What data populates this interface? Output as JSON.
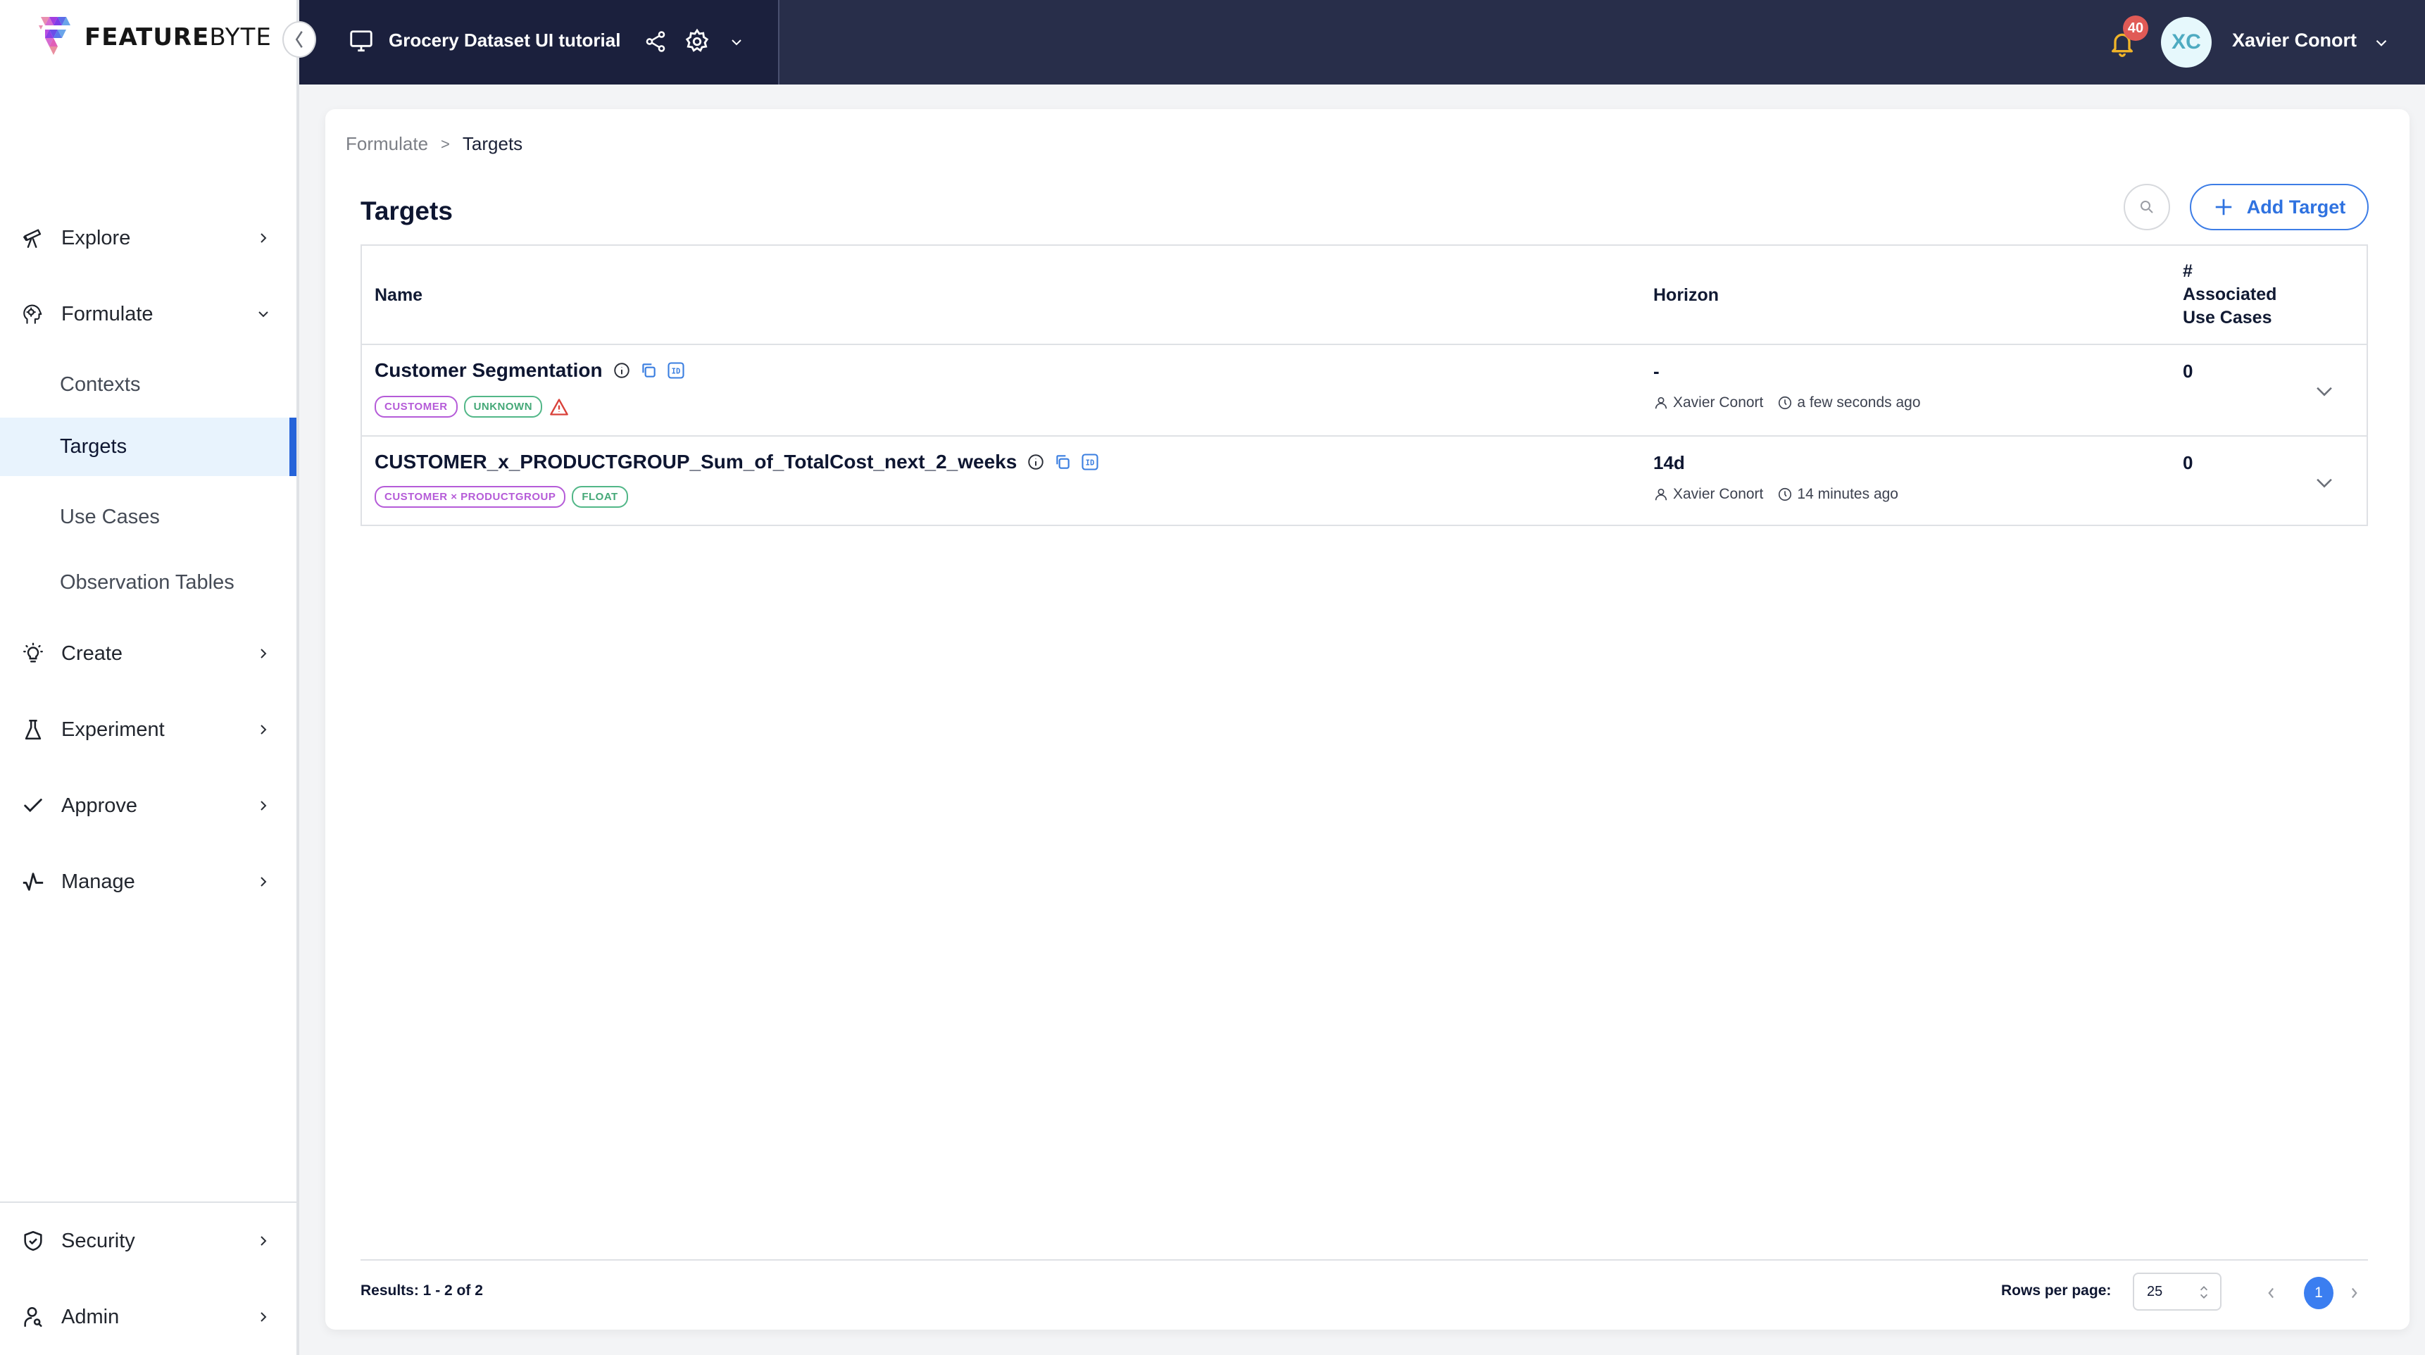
{
  "app": {
    "brand_bold": "FEATURE",
    "brand_light": "BYTE"
  },
  "header": {
    "project_title": "Grocery Dataset UI tutorial",
    "notification_count": "40",
    "user_initials": "XC",
    "user_name": "Xavier Conort"
  },
  "sidebar": {
    "items": [
      {
        "label": "Explore",
        "icon": "telescope-icon",
        "state": "collapsed"
      },
      {
        "label": "Formulate",
        "icon": "brain-gear-icon",
        "state": "expanded"
      },
      {
        "label": "Create",
        "icon": "lightbulb-icon",
        "state": "collapsed"
      },
      {
        "label": "Experiment",
        "icon": "flask-icon",
        "state": "collapsed"
      },
      {
        "label": "Approve",
        "icon": "check-icon",
        "state": "collapsed"
      },
      {
        "label": "Manage",
        "icon": "pulse-icon",
        "state": "collapsed"
      }
    ],
    "formulate_children": [
      {
        "label": "Contexts",
        "active": false
      },
      {
        "label": "Targets",
        "active": true
      },
      {
        "label": "Use Cases",
        "active": false
      },
      {
        "label": "Observation Tables",
        "active": false
      }
    ],
    "bottom_items": [
      {
        "label": "Security",
        "icon": "shield-check-icon"
      },
      {
        "label": "Admin",
        "icon": "user-search-icon"
      }
    ]
  },
  "breadcrumb": {
    "parent": "Formulate",
    "separator": ">",
    "current": "Targets"
  },
  "page": {
    "title": "Targets",
    "add_button_label": "Add Target"
  },
  "table": {
    "columns": {
      "name": "Name",
      "horizon": "Horizon",
      "assoc_line1": "#",
      "assoc_line2": "Associated",
      "assoc_line3": "Use Cases"
    },
    "rows": [
      {
        "name": "Customer Segmentation",
        "entity_tag": "CUSTOMER",
        "type_tag": "UNKNOWN",
        "warning": true,
        "horizon": "-",
        "author": "Xavier Conort",
        "updated": "a few seconds ago",
        "associated_use_cases": "0"
      },
      {
        "name": "CUSTOMER_x_PRODUCTGROUP_Sum_of_TotalCost_next_2_weeks",
        "entity_tag": "CUSTOMER × PRODUCTGROUP",
        "type_tag": "FLOAT",
        "warning": false,
        "horizon": "14d",
        "author": "Xavier Conort",
        "updated": "14 minutes ago",
        "associated_use_cases": "0"
      }
    ]
  },
  "footer": {
    "results": "Results: 1 - 2 of 2",
    "rows_per_page_label": "Rows per page:",
    "rows_per_page_value": "25",
    "current_page": "1"
  },
  "colors": {
    "header_dark": "#1b203d",
    "header": "#282e4a",
    "accent": "#2f72e0",
    "active_bg": "#e8f3fd",
    "active_bar": "#2563d9",
    "entity_tag": "#b55bd8",
    "type_tag": "#44a877",
    "warning": "#d9413a",
    "badge": "#e05a56",
    "bell": "#f0b429"
  }
}
